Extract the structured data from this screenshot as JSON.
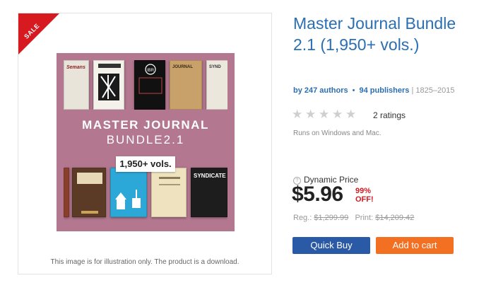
{
  "product": {
    "sale_badge": "SALE",
    "title": "Master Journal Bundle 2.1 (1,950+ vols.)",
    "authors_link": "by 247 authors",
    "publishers_link": "94 publishers",
    "separator_dot": "•",
    "year_range": "| 1825–2015",
    "ratings_count": "2 ratings",
    "rating_value": 0,
    "rating_max": 5,
    "platforms": "Runs on Windows and Mac.",
    "image_caption": "This image is for illustration only. The product is a download."
  },
  "cover": {
    "title": "MASTER JOURNAL",
    "subtitle": "BUNDLE2.1",
    "badge": "1,950+ vols.",
    "book_labels": [
      "Semans",
      "",
      "IBR BULLETIN",
      "JOURNAL",
      "SYND",
      "",
      "",
      "",
      "",
      "SYNDICATE"
    ]
  },
  "pricing": {
    "label": "Dynamic Price",
    "help_icon": "?",
    "price": "$5.96",
    "discount_pct": "99%",
    "discount_off": "OFF!",
    "reg_label": "Reg.:",
    "reg_price": "$1,299.99",
    "print_label": "Print:",
    "print_price": "$14,209.42"
  },
  "actions": {
    "quick_buy": "Quick Buy",
    "add_to_cart": "Add to cart"
  },
  "colors": {
    "link": "#2a6fb3",
    "sale": "#d71920",
    "quick_buy": "#2a5aa6",
    "add_to_cart": "#f36f21",
    "cover_bg": "#b3778f"
  }
}
